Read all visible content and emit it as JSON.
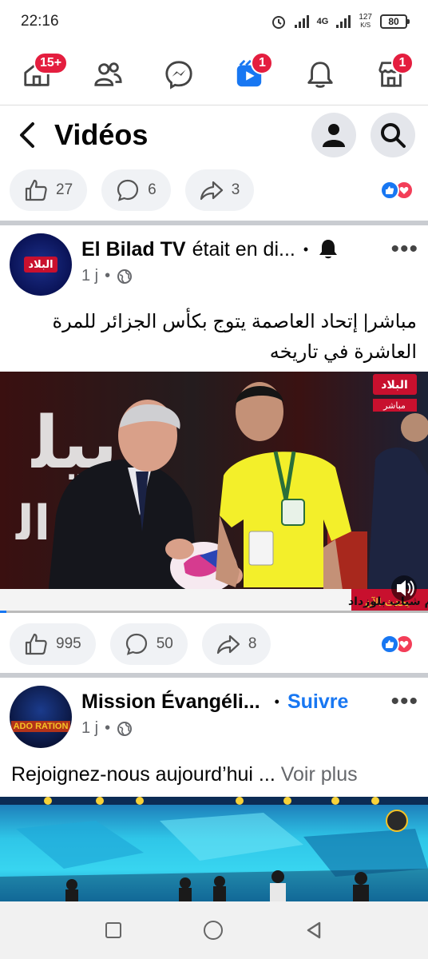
{
  "status_bar": {
    "time": "22:16",
    "network": "4G",
    "speed_top": "127",
    "speed_bottom": "K/S",
    "battery": "80"
  },
  "top_nav": {
    "items": [
      {
        "icon": "home-icon",
        "badge": "15+"
      },
      {
        "icon": "friends-icon",
        "badge": ""
      },
      {
        "icon": "messenger-icon",
        "badge": ""
      },
      {
        "icon": "video-icon",
        "badge": "1",
        "active": true
      },
      {
        "icon": "bell-icon",
        "badge": ""
      },
      {
        "icon": "marketplace-icon",
        "badge": "1"
      }
    ]
  },
  "page_header": {
    "title": "Vidéos"
  },
  "post0_reactions": {
    "likes": "27",
    "comments": "6",
    "shares": "3"
  },
  "post1": {
    "author": "El Bilad TV",
    "action": "était en di...",
    "time": "1 j",
    "text_line1": "مباشر| إتحاد العاصمة يتوج بكأس الجزائر للمرة",
    "text_line2": "العاشرة في تاريخه",
    "video_ticker": "تتويج اتحاد العاصمة جاء بعد فوزه في النهائي أمام شباب بلوزداد",
    "video_logo": "البلاد",
    "video_live": "مباشر",
    "video_tag": "يحدث الآن",
    "reactions": {
      "likes": "995",
      "comments": "50",
      "shares": "8"
    }
  },
  "post2": {
    "author": "Mission Évangéli...",
    "follow": "Suivre",
    "time": "1 j",
    "text": "Rejoignez-nous aujourd’hui ...",
    "more": "Voir plus",
    "avatar_text": "ADO RATION"
  },
  "colors": {
    "accent": "#1877f2",
    "badge": "#e41e3f",
    "pill_bg": "#f0f2f5",
    "divider": "#c9ccd1"
  },
  "android_nav": [
    "recent-apps-button",
    "home-button",
    "back-button"
  ]
}
